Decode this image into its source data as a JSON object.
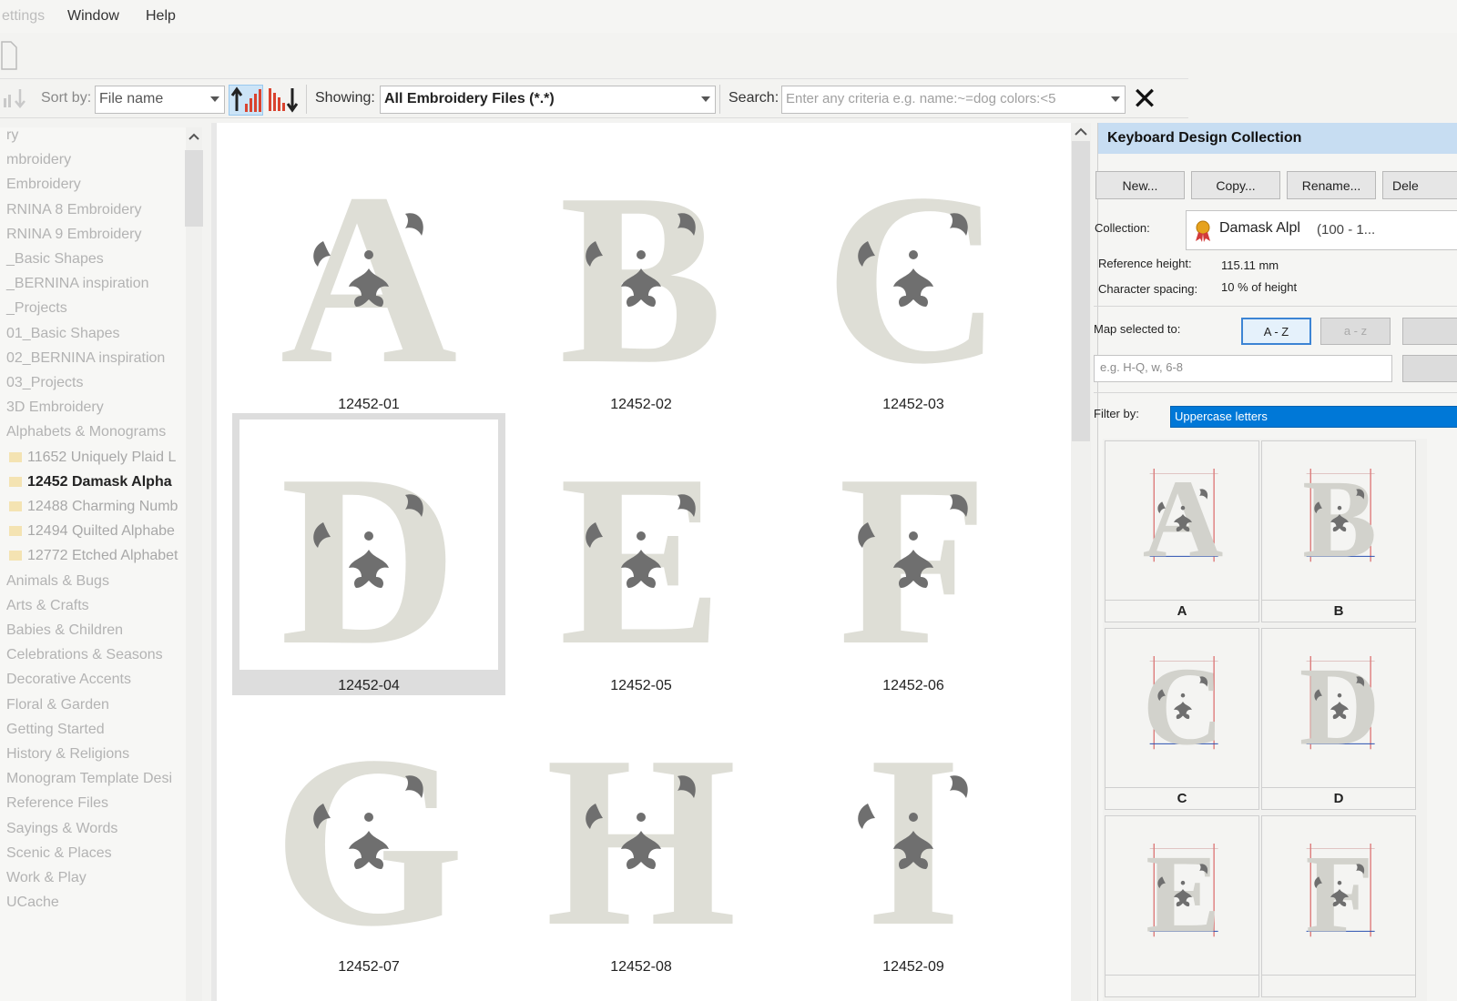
{
  "menu": {
    "items": [
      "ettings",
      "Window",
      "Help"
    ]
  },
  "toolbar": {
    "sort_label": "Sort by:",
    "sort_value": "File name",
    "showing_label": "Showing:",
    "showing_value": "All Embroidery Files (*.*)",
    "search_label": "Search:",
    "search_placeholder": "Enter any criteria e.g. name:~=dog colors:<5",
    "close_glyph": "✕"
  },
  "tree": {
    "items": [
      {
        "label": "ry",
        "kind": "node"
      },
      {
        "label": "mbroidery",
        "kind": "node"
      },
      {
        "label": " Embroidery",
        "kind": "node"
      },
      {
        "label": "RNINA 8 Embroidery",
        "kind": "node"
      },
      {
        "label": "RNINA 9 Embroidery",
        "kind": "node"
      },
      {
        "label": "_Basic Shapes",
        "kind": "node"
      },
      {
        "label": "_BERNINA inspiration",
        "kind": "node"
      },
      {
        "label": "_Projects",
        "kind": "node"
      },
      {
        "label": "01_Basic Shapes",
        "kind": "node"
      },
      {
        "label": "02_BERNINA inspiration",
        "kind": "node"
      },
      {
        "label": "03_Projects",
        "kind": "node"
      },
      {
        "label": "3D Embroidery",
        "kind": "node"
      },
      {
        "label": "Alphabets & Monograms",
        "kind": "node"
      },
      {
        "label": "11652 Uniquely Plaid L",
        "kind": "child"
      },
      {
        "label": "12452 Damask Alpha",
        "kind": "selected"
      },
      {
        "label": "12488 Charming Numb",
        "kind": "child"
      },
      {
        "label": "12494 Quilted Alphabe",
        "kind": "child"
      },
      {
        "label": "12772 Etched Alphabet",
        "kind": "child"
      },
      {
        "label": "Animals & Bugs",
        "kind": "node"
      },
      {
        "label": "Arts & Crafts",
        "kind": "node"
      },
      {
        "label": "Babies & Children",
        "kind": "node"
      },
      {
        "label": "Celebrations & Seasons",
        "kind": "node"
      },
      {
        "label": "Decorative Accents",
        "kind": "node"
      },
      {
        "label": "Floral & Garden",
        "kind": "node"
      },
      {
        "label": "Getting Started",
        "kind": "node"
      },
      {
        "label": "History & Religions",
        "kind": "node"
      },
      {
        "label": "Monogram Template Desi",
        "kind": "node"
      },
      {
        "label": "Reference Files",
        "kind": "node"
      },
      {
        "label": "Sayings & Words",
        "kind": "node"
      },
      {
        "label": "Scenic & Places",
        "kind": "node"
      },
      {
        "label": "Work & Play",
        "kind": "node"
      },
      {
        "label": "UCache",
        "kind": "node"
      }
    ]
  },
  "gallery": {
    "tiles": [
      {
        "letter": "A",
        "caption": "12452-01",
        "selected": false
      },
      {
        "letter": "B",
        "caption": "12452-02",
        "selected": false
      },
      {
        "letter": "C",
        "caption": "12452-03",
        "selected": false
      },
      {
        "letter": "D",
        "caption": "12452-04",
        "selected": true
      },
      {
        "letter": "E",
        "caption": "12452-05",
        "selected": false
      },
      {
        "letter": "F",
        "caption": "12452-06",
        "selected": false
      },
      {
        "letter": "G",
        "caption": "12452-07",
        "selected": false
      },
      {
        "letter": "H",
        "caption": "12452-08",
        "selected": false
      },
      {
        "letter": "I",
        "caption": "12452-09",
        "selected": false
      }
    ]
  },
  "panel": {
    "title": "Keyboard Design Collection",
    "buttons": [
      "New...",
      "Copy...",
      "Rename...",
      "Dele"
    ],
    "collection_label": "Collection:",
    "collection_name": "Damask Alpl",
    "collection_range": "(100 - 1...",
    "ref_height_label": "Reference height:",
    "ref_height_value": "115.11 mm",
    "char_spacing_label": "Character spacing:",
    "char_spacing_value": "10 % of height",
    "map_label": "Map selected to:",
    "map_upper": "A - Z",
    "map_lower": "a - z",
    "map_placeholder": "e.g. H-Q, w, 6-8",
    "filter_label": "Filter by:",
    "filter_value": "Uppercase letters",
    "thumbs": [
      {
        "letter": "A",
        "label": "A"
      },
      {
        "letter": "B",
        "label": "B"
      },
      {
        "letter": "C",
        "label": "C"
      },
      {
        "letter": "D",
        "label": "D"
      },
      {
        "letter": "E",
        "label": ""
      },
      {
        "letter": "F",
        "label": ""
      }
    ]
  },
  "colors": {
    "accent": "#0078d7",
    "panel_header": "#c7ddf2",
    "stitch_light": "#deded6",
    "stitch_dark": "#6f6f6f",
    "guide_red": "#d23b3b",
    "guide_blue": "#2a4fb0"
  }
}
